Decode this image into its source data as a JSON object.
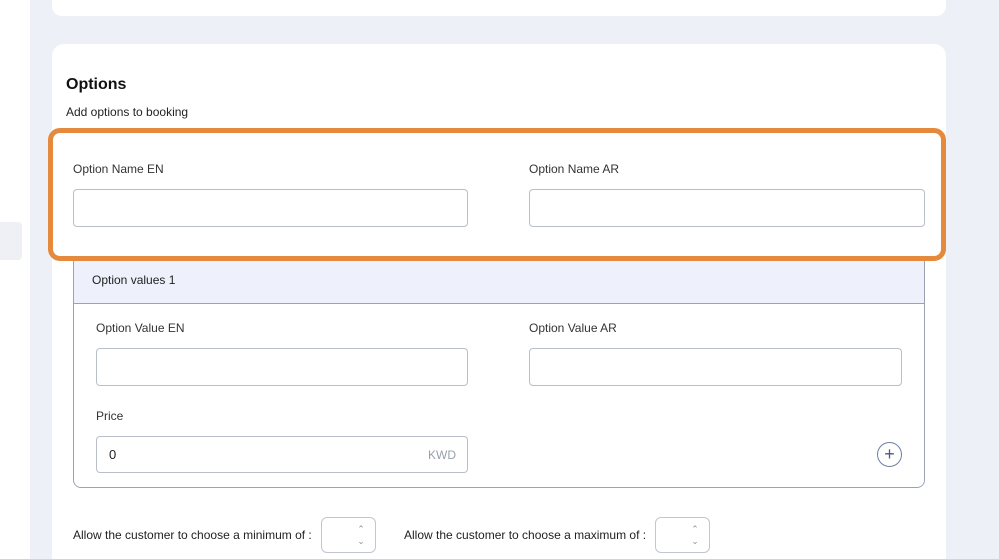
{
  "options": {
    "title": "Options",
    "subtitle": "Add options to booking",
    "name_en_label": "Option Name EN",
    "name_en_value": "",
    "name_ar_label": "Option Name AR",
    "name_ar_value": ""
  },
  "option_values": {
    "header": "Option values 1",
    "value_en_label": "Option Value EN",
    "value_en_value": "",
    "value_ar_label": "Option Value AR",
    "value_ar_value": "",
    "price_label": "Price",
    "price_value": "0",
    "price_currency": "KWD",
    "add_icon": "plus-circle-icon"
  },
  "limits": {
    "min_label": "Allow the customer to choose a minimum of :",
    "max_label": "Allow the customer to choose a maximum of :"
  },
  "colors": {
    "highlight": "#e58a3c",
    "page_background": "#eef0f7",
    "values_header_background": "#eef0fb"
  }
}
